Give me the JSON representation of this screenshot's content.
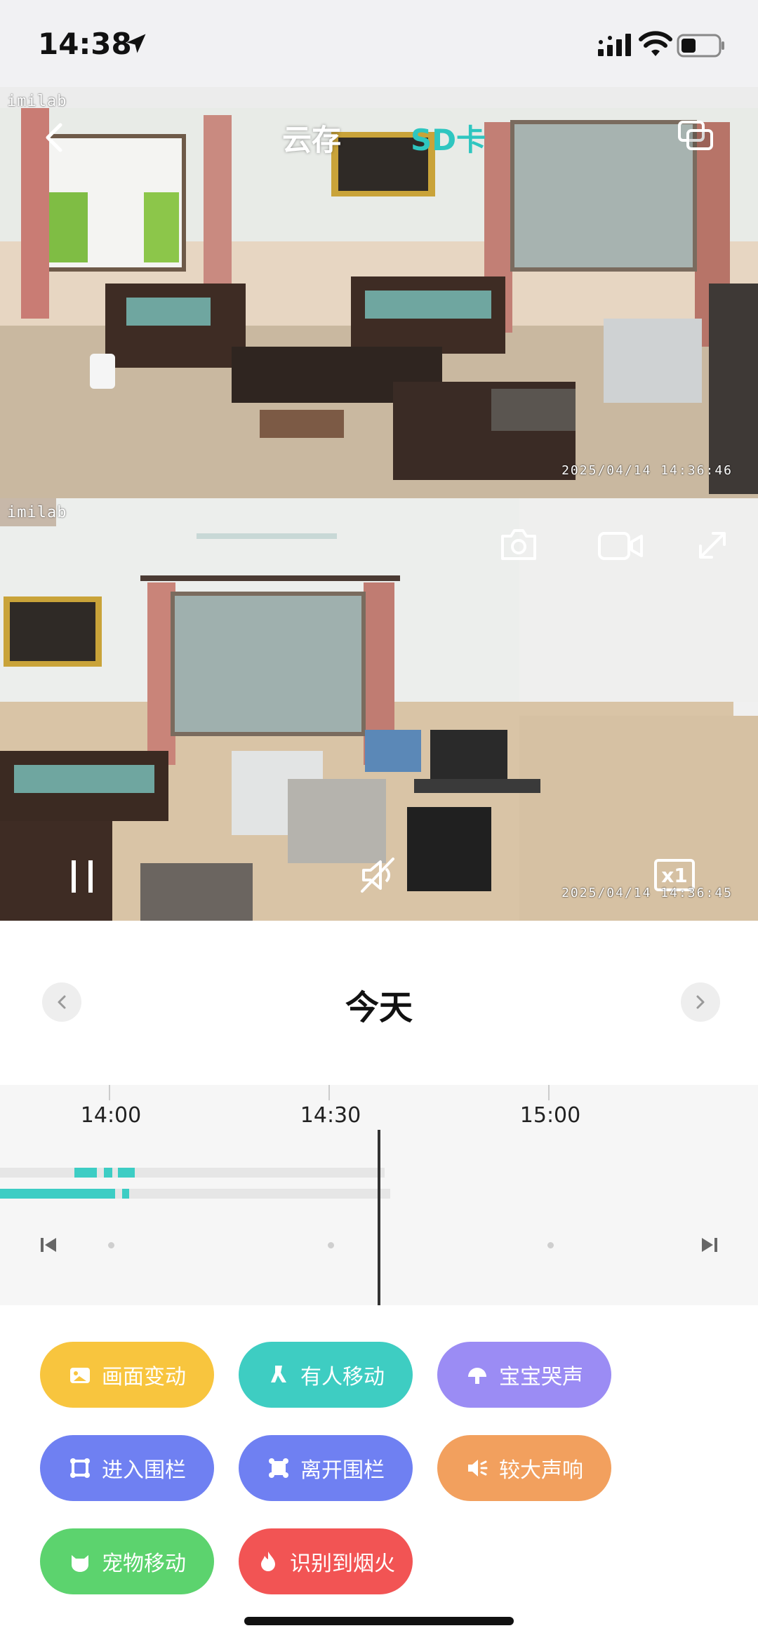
{
  "status_bar": {
    "time": "14:38",
    "location_icon": "location-arrow-icon",
    "signal_icon": "cellular-signal-icon",
    "wifi_icon": "wifi-icon",
    "battery_icon": "battery-icon"
  },
  "header": {
    "back_icon": "chevron-left-icon",
    "tabs": [
      {
        "label": "云存",
        "active": false
      },
      {
        "label": "SD卡",
        "active": true
      }
    ],
    "switch_icon": "dual-screen-icon",
    "active_color": "#2ec6c0"
  },
  "camera_top": {
    "brand": "imilab",
    "timestamp": "2025/04/14  14:36:46"
  },
  "camera_bottom": {
    "brand": "imilab",
    "timestamp": "2025/04/14  14:36:45",
    "controls": {
      "screenshot_icon": "camera-icon",
      "record_icon": "video-record-icon",
      "fullscreen_icon": "expand-icon",
      "pause_icon": "pause-icon",
      "mute_icon": "speaker-muted-icon",
      "speed_label": "x1"
    }
  },
  "date_nav": {
    "title": "今天",
    "prev_icon": "chevron-left-icon",
    "next_icon": "chevron-right-icon"
  },
  "timeline": {
    "ticks": [
      "14:00",
      "14:30",
      "15:00"
    ],
    "cursor_time": "14:36",
    "prev_icon": "skip-previous-icon",
    "next_icon": "skip-next-icon",
    "event_color": "#3dcdc4"
  },
  "filters": [
    {
      "label": "画面变动",
      "icon": "picture-icon",
      "color": "#f8c53e"
    },
    {
      "label": "有人移动",
      "icon": "person-walk-icon",
      "color": "#3ecdc2"
    },
    {
      "label": "宝宝哭声",
      "icon": "baby-icon",
      "color": "#9b8cf4"
    },
    {
      "label": "进入围栏",
      "icon": "fence-enter-icon",
      "color": "#6f80f2"
    },
    {
      "label": "离开围栏",
      "icon": "fence-leave-icon",
      "color": "#6f80f2"
    },
    {
      "label": "较大声响",
      "icon": "loud-sound-icon",
      "color": "#f2a05e"
    },
    {
      "label": "宠物移动",
      "icon": "pet-icon",
      "color": "#5cd36e"
    },
    {
      "label": "识别到烟火",
      "icon": "fire-icon",
      "color": "#f25454"
    }
  ]
}
